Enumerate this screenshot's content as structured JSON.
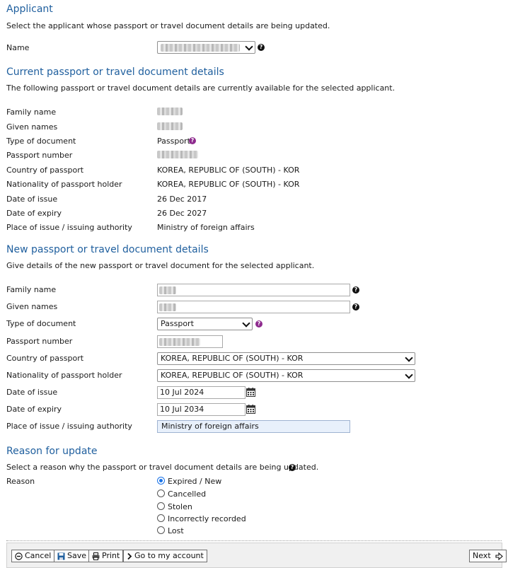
{
  "applicant": {
    "title": "Applicant",
    "intro": "Select the applicant whose passport or travel document details are being updated.",
    "name_label": "Name"
  },
  "current": {
    "title": "Current passport or travel document details",
    "intro": "The following passport or travel document details are currently available for the selected applicant.",
    "rows": [
      {
        "label": "Family name",
        "value": ""
      },
      {
        "label": "Given names",
        "value": ""
      },
      {
        "label": "Type of document",
        "value": "Passport"
      },
      {
        "label": "Passport number",
        "value": ""
      },
      {
        "label": "Country of passport",
        "value": "KOREA, REPUBLIC OF (SOUTH) - KOR"
      },
      {
        "label": "Nationality of passport holder",
        "value": "KOREA, REPUBLIC OF (SOUTH) - KOR"
      },
      {
        "label": "Date of issue",
        "value": "26 Dec 2017"
      },
      {
        "label": "Date of expiry",
        "value": "26 Dec 2027"
      },
      {
        "label": "Place of issue / issuing authority",
        "value": "Ministry of foreign affairs"
      }
    ]
  },
  "new": {
    "title": "New passport or travel document details",
    "intro": "Give details of the new passport or travel document for the selected applicant.",
    "family_name_label": "Family name",
    "given_names_label": "Given names",
    "type_label": "Type of document",
    "type_value": "Passport",
    "passport_number_label": "Passport number",
    "country_label": "Country of passport",
    "country_value": "KOREA, REPUBLIC OF (SOUTH) - KOR",
    "nationality_label": "Nationality of passport holder",
    "nationality_value": "KOREA, REPUBLIC OF (SOUTH) - KOR",
    "issue_label": "Date of issue",
    "issue_value": "10 Jul 2024",
    "expiry_label": "Date of expiry",
    "expiry_value": "10 Jul 2034",
    "place_label": "Place of issue / issuing authority",
    "place_value": "Ministry of foreign affairs"
  },
  "reason": {
    "title": "Reason for update",
    "intro": "Select a reason why the passport or travel document details are being updated.",
    "label": "Reason",
    "options": [
      "Expired / New",
      "Cancelled",
      "Stolen",
      "Incorrectly recorded",
      "Lost"
    ],
    "selected": "Expired / New"
  },
  "footer": {
    "cancel": "Cancel",
    "save": "Save",
    "print": "Print",
    "account": "Go to my account",
    "next": "Next"
  },
  "colors": {
    "heading": "#1f5f9e",
    "help_purple": "#8e2a8e",
    "radio_selected": "#1a73e8"
  }
}
